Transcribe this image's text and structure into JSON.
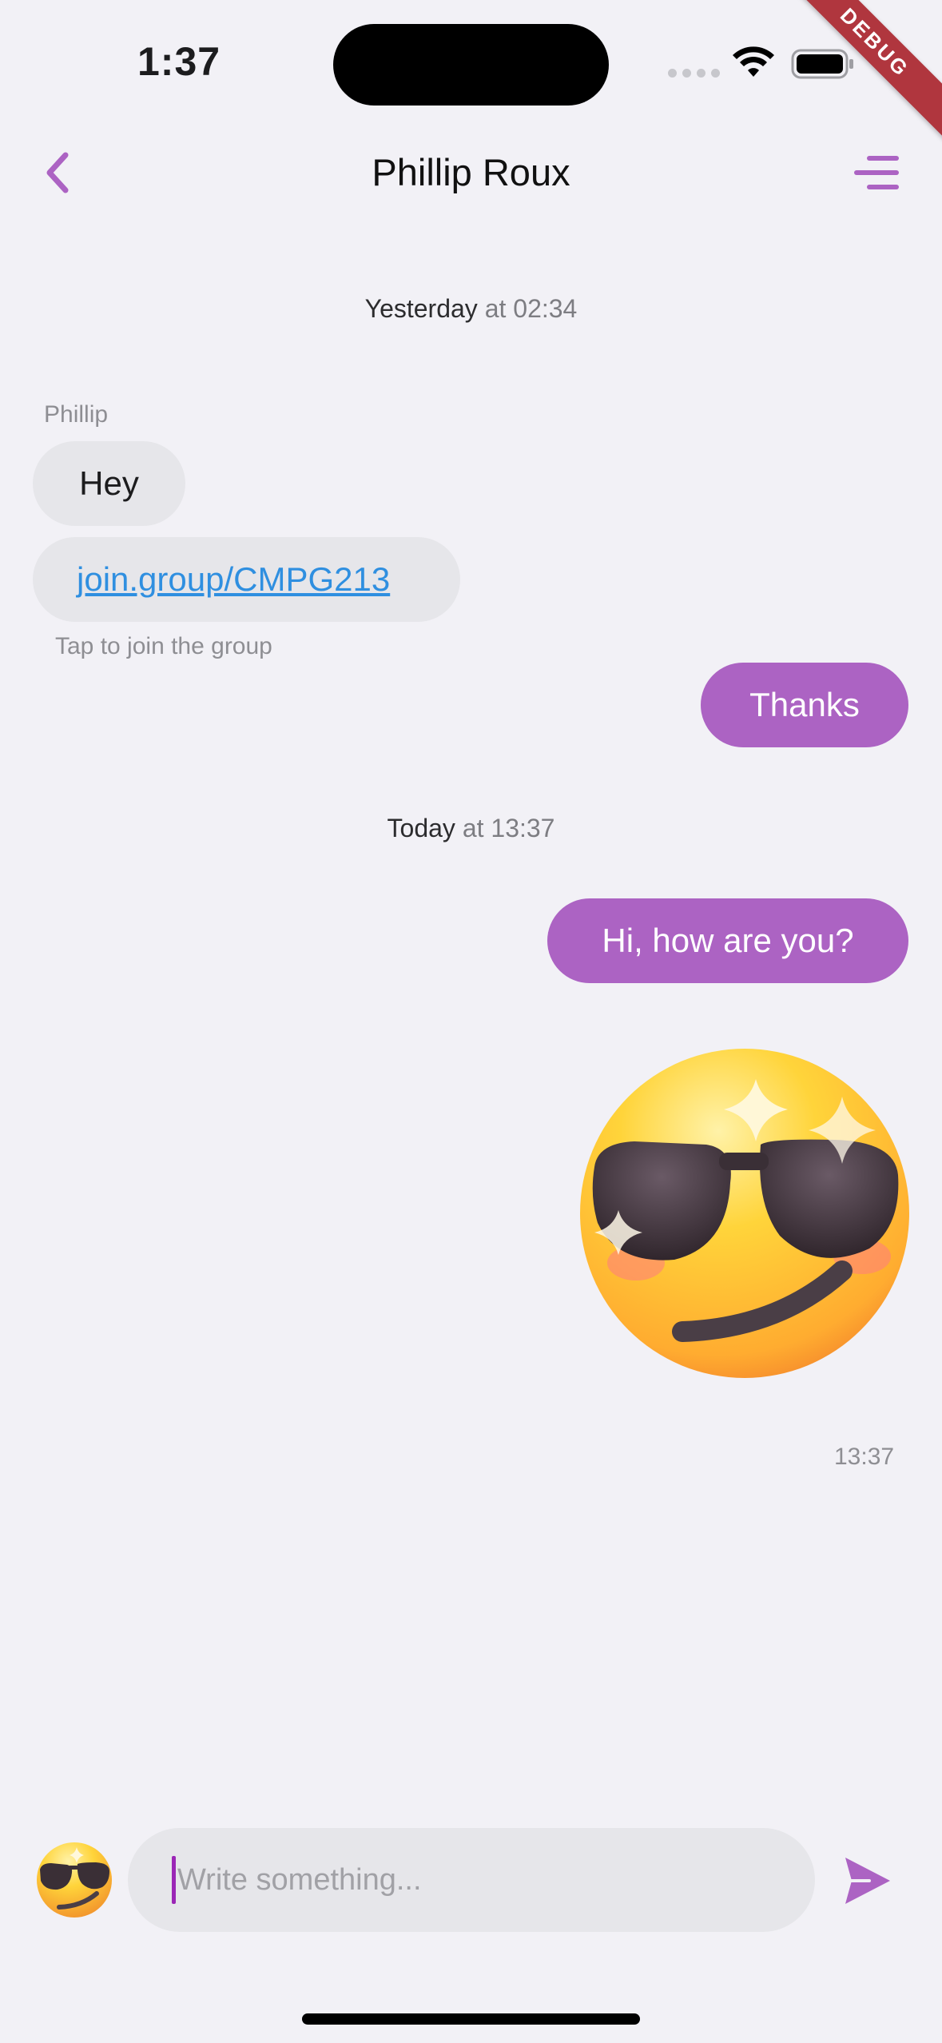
{
  "status_bar": {
    "time": "1:37",
    "debug_label": "DEBUG"
  },
  "header": {
    "title": "Phillip Roux",
    "back_icon": "chevron-left-icon",
    "menu_icon": "menu-icon"
  },
  "colors": {
    "accent": "#ac63c3",
    "link": "#2f8fe0",
    "bubble_incoming": "#e6e6ea",
    "background": "#f2f1f6"
  },
  "chat": {
    "separators": [
      {
        "day": "Yesterday",
        "time": "at 02:34"
      },
      {
        "day": "Today",
        "time": "at 13:37"
      }
    ],
    "sender_name": "Phillip",
    "messages": [
      {
        "direction": "incoming",
        "text": "Hey"
      },
      {
        "direction": "incoming",
        "text": "join.group/CMPG213",
        "caption": "Tap to join the group"
      },
      {
        "direction": "outgoing",
        "text": "Thanks"
      },
      {
        "direction": "outgoing",
        "text": "Hi, how are you?"
      },
      {
        "direction": "outgoing",
        "sticker": "smiling-face-with-sunglasses",
        "time": "13:37"
      }
    ]
  },
  "composer": {
    "placeholder": "Write something...",
    "emoji_icon": "sunglasses-emoji-icon",
    "send_icon": "send-icon"
  }
}
